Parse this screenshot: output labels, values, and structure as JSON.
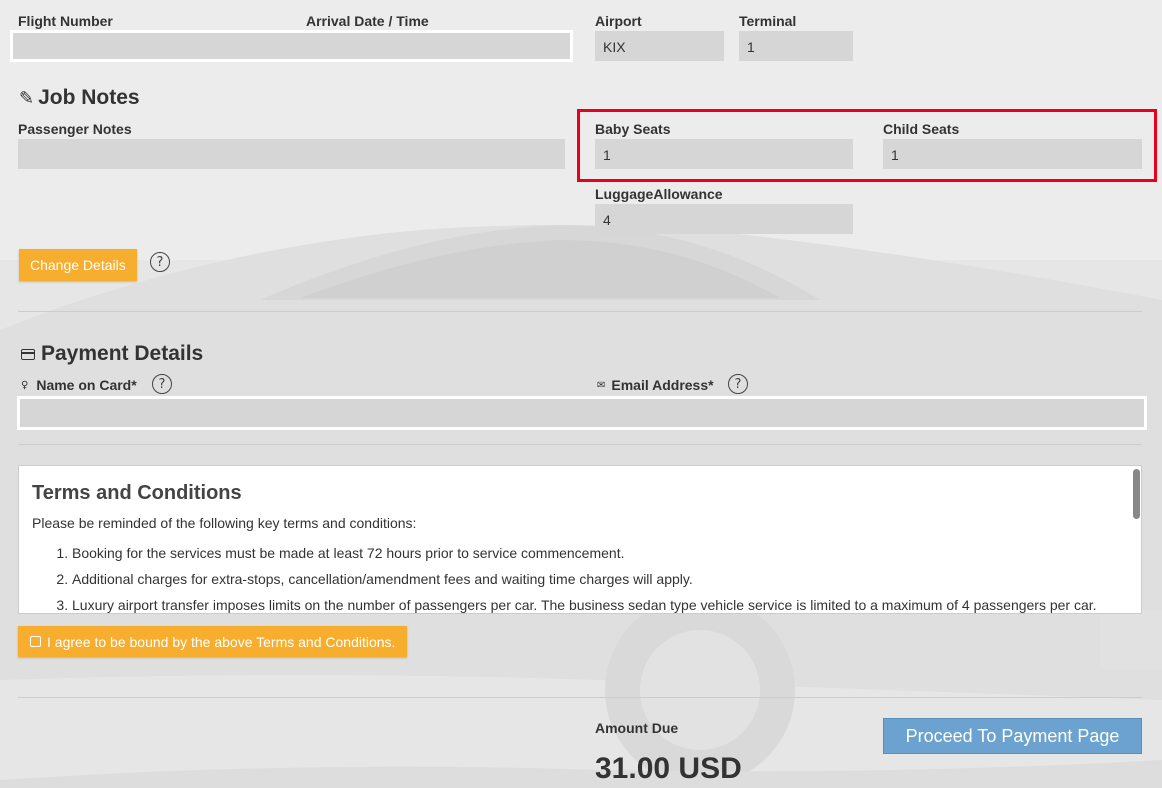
{
  "flight": {
    "flight_number_label": "Flight Number",
    "arrival_label": "Arrival Date / Time",
    "flight_number_value": "",
    "airport_label": "Airport",
    "airport_value": "KIX",
    "terminal_label": "Terminal",
    "terminal_value": "1"
  },
  "job_notes": {
    "title": "Job Notes",
    "passenger_notes_label": "Passenger Notes",
    "passenger_notes_value": "",
    "baby_seats_label": "Baby Seats",
    "baby_seats_value": "1",
    "child_seats_label": "Child Seats",
    "child_seats_value": "1",
    "luggage_label": "LuggageAllowance",
    "luggage_value": "4",
    "change_details_button": "Change Details",
    "help_glyph": "?"
  },
  "payment": {
    "title": "Payment Details",
    "name_label": "Name on Card*",
    "email_label": "Email Address*",
    "name_value": "",
    "email_value": ""
  },
  "terms": {
    "title": "Terms and Conditions",
    "intro": "Please be reminded of the following key terms and conditions:",
    "items": [
      "Booking for the services must be made at least 72 hours prior to service commencement.",
      "Additional charges for extra-stops, cancellation/amendment fees and waiting time charges will apply.",
      "Luxury airport transfer imposes limits on the number of passengers per car. The business sedan type vehicle service is limited to a maximum of 4 passengers per car."
    ],
    "agree_label": "I agree to be bound by the above Terms and Conditions.",
    "agreed": false
  },
  "summary": {
    "amount_label": "Amount Due",
    "amount_value": "31.00 USD",
    "proceed_button": "Proceed To Payment Page"
  },
  "colors": {
    "accent_orange": "#f7ad2d",
    "button_blue": "#6ba2cf",
    "highlight_red": "#e8001c",
    "field_gray": "#d6d6d6"
  },
  "icons": {
    "job_notes": "edit-icon",
    "payment": "credit-card-icon",
    "name": "user-icon",
    "email": "envelope-icon",
    "help": "question-circle-icon"
  }
}
